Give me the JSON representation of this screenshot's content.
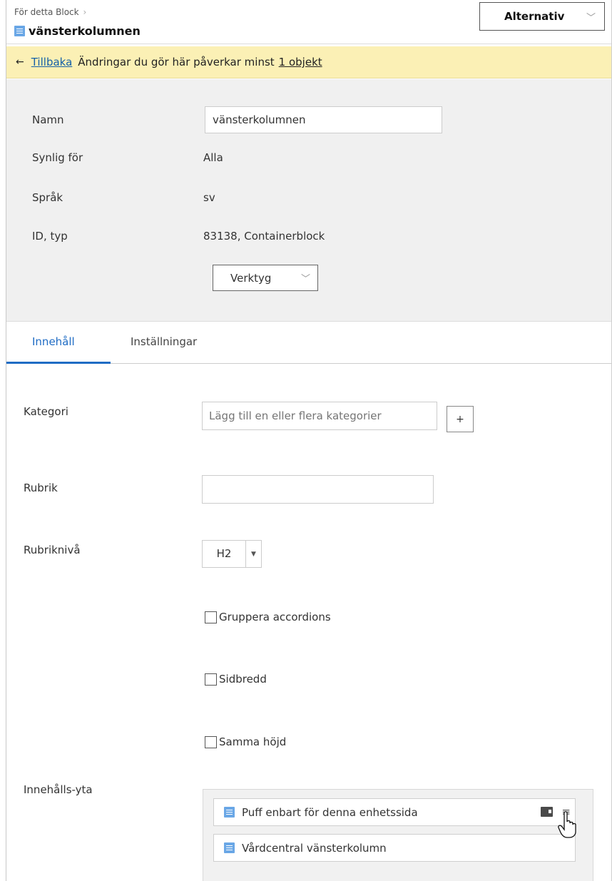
{
  "header": {
    "breadcrumb": "För detta Block",
    "title": "vänsterkolumnen",
    "options_button": "Alternativ"
  },
  "notice": {
    "back_link": "Tillbaka",
    "message": "Ändringar du gör här påverkar minst",
    "object_link": "1 objekt"
  },
  "properties": {
    "name_label": "Namn",
    "name_value": "vänsterkolumnen",
    "visible_label": "Synlig för",
    "visible_value": "Alla",
    "language_label": "Språk",
    "language_value": "sv",
    "id_label": "ID, typ",
    "id_value": "83138, Containerblock",
    "tools_button": "Verktyg"
  },
  "tabs": [
    {
      "label": "Innehåll",
      "active": true
    },
    {
      "label": "Inställningar",
      "active": false
    }
  ],
  "form": {
    "category_label": "Kategori",
    "category_placeholder": "Lägg till en eller flera kategorier",
    "add_button": "+",
    "heading_label": "Rubrik",
    "heading_value": "",
    "heading_level_label": "Rubriknivå",
    "heading_level_value": "H2",
    "group_accordions": "Gruppera accordions",
    "page_width": "Sidbredd",
    "same_height": "Samma höjd",
    "content_area_label": "Innehålls-yta",
    "content_items": [
      "Puff enbart för denna enhetssida",
      "Vårdcentral vänsterkolumn"
    ]
  },
  "colors": {
    "accent": "#1f6cc4",
    "notice_bg": "#fbf0b5",
    "panel_bg": "#f0f0f0",
    "block_icon": "#6aa7e6"
  },
  "icons": [
    "block-icon",
    "arrow-left-icon",
    "chevron-down-icon",
    "folder-icon",
    "menu-icon",
    "hand-cursor-icon"
  ]
}
